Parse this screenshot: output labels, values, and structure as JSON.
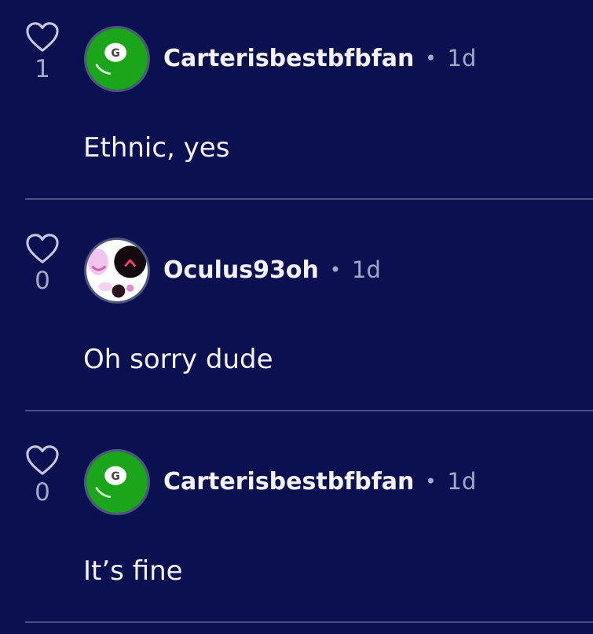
{
  "colors": {
    "background": "#0b1150",
    "divider": "#4c5283",
    "muted_text": "#a3a8c6",
    "primary_text": "#f3f3f7"
  },
  "comments": [
    {
      "like_count": "1",
      "username": "Carterisbestbfbfan",
      "separator": "•",
      "time": "1d",
      "text": "Ethnic, yes",
      "avatar": "green-8-ball-avatar",
      "avatar_letter": "G"
    },
    {
      "like_count": "0",
      "username": "Oculus93oh",
      "separator": "•",
      "time": "1d",
      "text": "Oh sorry dude",
      "avatar": "pink-ghost-face-avatar"
    },
    {
      "like_count": "0",
      "username": "Carterisbestbfbfan",
      "separator": "•",
      "time": "1d",
      "text": "It’s fine",
      "avatar": "green-8-ball-avatar",
      "avatar_letter": "G"
    }
  ]
}
